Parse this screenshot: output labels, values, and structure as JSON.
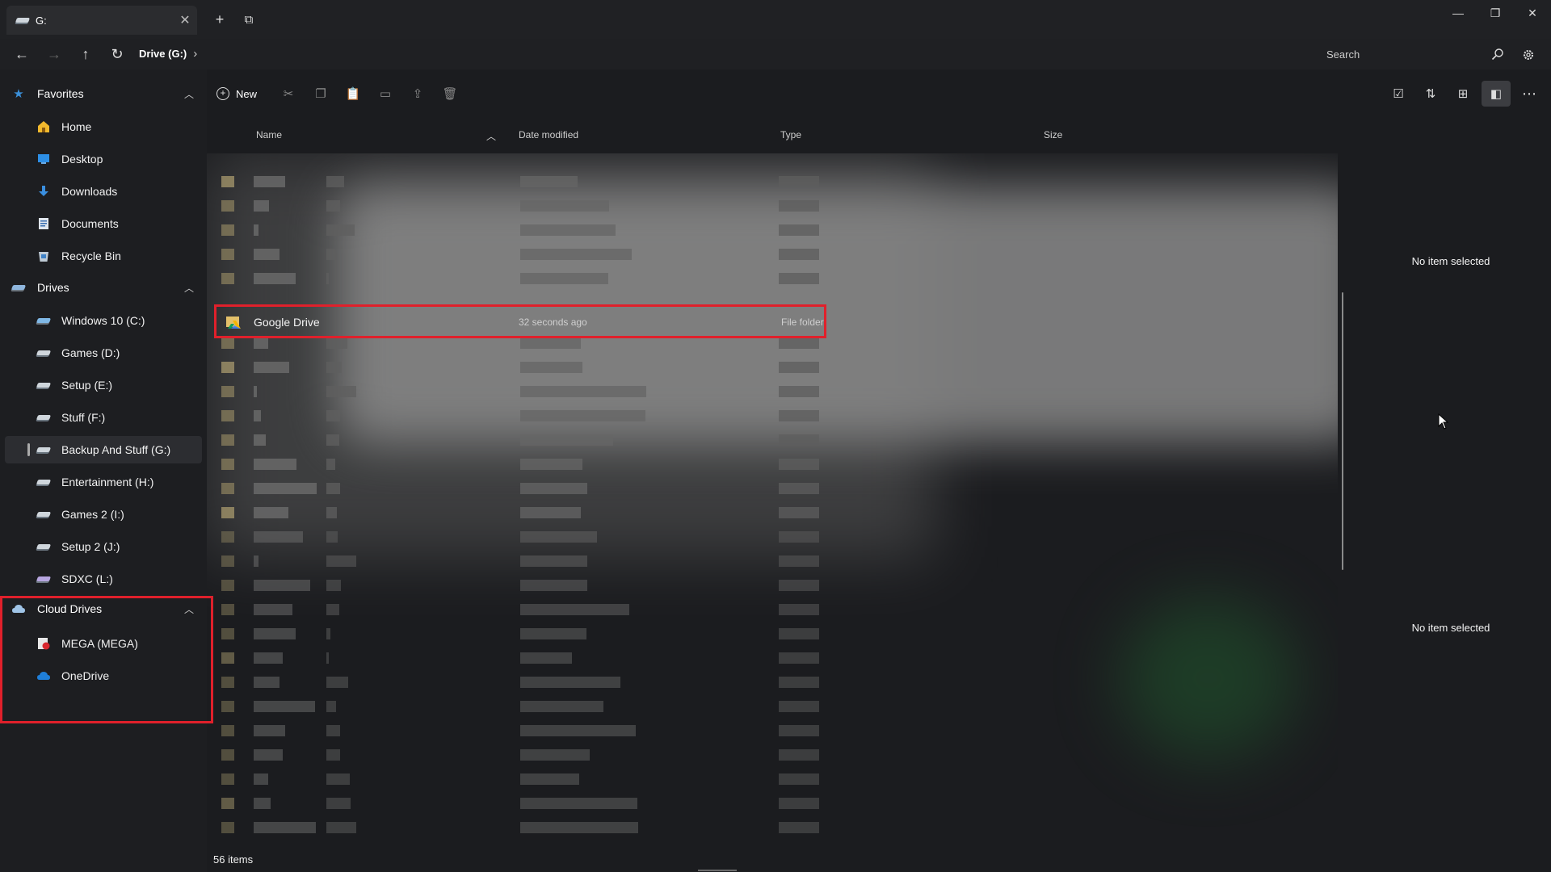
{
  "tab": {
    "title": "G:",
    "icon": "drive-icon"
  },
  "window_controls": {
    "minimize": "—",
    "maximize": "❐",
    "close": "✕"
  },
  "titlebar": {
    "new_tab": "+",
    "tab_actions": "⧉"
  },
  "nav": {
    "back": "←",
    "forward": "→",
    "up": "↑",
    "refresh": "↻"
  },
  "breadcrumb": {
    "items": [
      "Drive (G:)"
    ],
    "separator": "›"
  },
  "search": {
    "placeholder": "Search"
  },
  "sidebar": {
    "favorites": {
      "label": "Favorites",
      "items": [
        {
          "label": "Home",
          "icon": "home-icon"
        },
        {
          "label": "Desktop",
          "icon": "desktop-icon"
        },
        {
          "label": "Downloads",
          "icon": "downloads-icon"
        },
        {
          "label": "Documents",
          "icon": "documents-icon"
        },
        {
          "label": "Recycle Bin",
          "icon": "recycle-bin-icon"
        }
      ]
    },
    "drives": {
      "label": "Drives",
      "items": [
        {
          "label": "Windows 10 (C:)"
        },
        {
          "label": "Games (D:)"
        },
        {
          "label": "Setup (E:)"
        },
        {
          "label": "Stuff (F:)"
        },
        {
          "label": "Backup And Stuff (G:)",
          "active": true
        },
        {
          "label": "Entertainment (H:)"
        },
        {
          "label": "Games 2 (I:)"
        },
        {
          "label": "Setup 2 (J:)"
        },
        {
          "label": "SDXC (L:)"
        }
      ]
    },
    "cloud": {
      "label": "Cloud Drives",
      "items": [
        {
          "label": "MEGA (MEGA)",
          "icon": "mega-icon"
        },
        {
          "label": "OneDrive",
          "icon": "onedrive-icon"
        }
      ]
    }
  },
  "toolbar": {
    "new_label": "New"
  },
  "columns": {
    "name": "Name",
    "date": "Date modified",
    "type": "Type",
    "size": "Size"
  },
  "highlighted_file": {
    "name": "Google Drive",
    "date": "32 seconds ago",
    "type": "File folder"
  },
  "status": {
    "items": "56 items"
  },
  "preview": {
    "top_text": "No item selected",
    "bottom_text": "No item selected"
  },
  "colors": {
    "accent": "#e0202b",
    "background": "#1b1c1f"
  }
}
